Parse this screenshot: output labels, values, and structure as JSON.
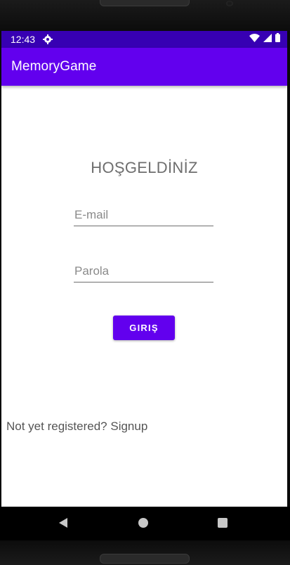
{
  "status_bar": {
    "time": "12:43",
    "icons": [
      "gear-icon",
      "wifi-icon",
      "signal-icon",
      "battery-icon"
    ]
  },
  "app_bar": {
    "title": "MemoryGame"
  },
  "login": {
    "welcome": "HOŞGELDİNİZ",
    "email_placeholder": "E-mail",
    "password_placeholder": "Parola",
    "login_label": "GIRIŞ",
    "signup_text": "Not yet registered? Signup"
  },
  "nav_bar": {
    "icons": [
      "back-icon",
      "home-icon",
      "recents-icon"
    ]
  },
  "colors": {
    "status_bar": "#3700b3",
    "primary": "#6200ee",
    "text_gray": "#6e6e6e"
  }
}
